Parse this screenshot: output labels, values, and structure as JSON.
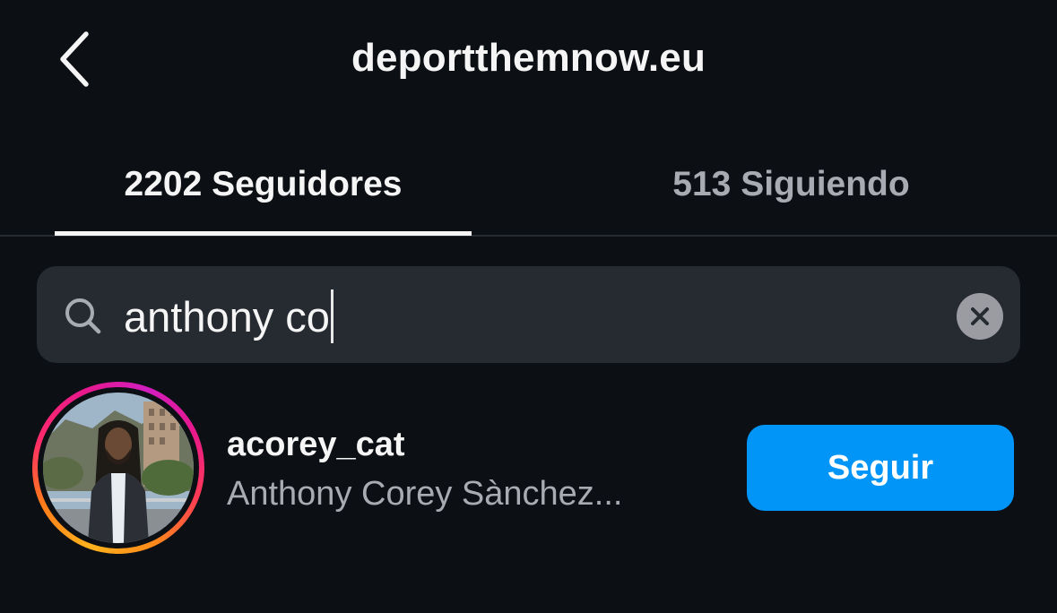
{
  "header": {
    "title": "deportthemnow.eu",
    "back_icon": "chevron-left-icon"
  },
  "tabs": [
    {
      "label": "2202 Seguidores",
      "active": true
    },
    {
      "label": "513 Siguiendo",
      "active": false
    }
  ],
  "search": {
    "value": "anthony co",
    "icon": "search-icon",
    "clear_icon": "close-icon"
  },
  "results": [
    {
      "username": "acorey_cat",
      "full_name": "Anthony Corey Sànchez...",
      "action_label": "Seguir",
      "has_story_ring": true
    }
  ],
  "colors": {
    "background": "#0c0f14",
    "primary_text": "#f5f5f5",
    "secondary_text": "#a8abb1",
    "search_background": "#262a31",
    "follow_button": "#0095f6"
  }
}
